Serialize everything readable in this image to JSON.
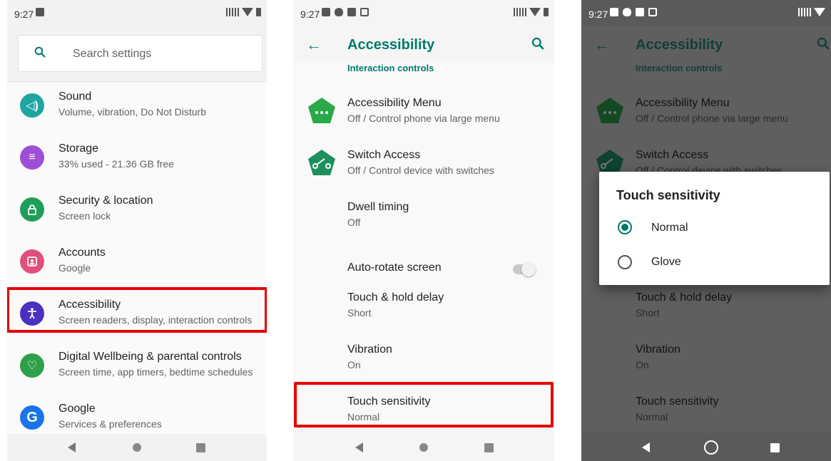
{
  "status": {
    "time": "9:27"
  },
  "screen1": {
    "search_placeholder": "Search settings",
    "items": [
      {
        "title": "Sound",
        "subtitle": "Volume, vibration, Do Not Disturb",
        "icon": "volume-icon",
        "color": "#1ea5a0"
      },
      {
        "title": "Storage",
        "subtitle": "33% used - 21.36 GB free",
        "icon": "storage-icon",
        "color": "#9c4fd6"
      },
      {
        "title": "Security & location",
        "subtitle": "Screen lock",
        "icon": "lock-icon",
        "color": "#1e9e5a"
      },
      {
        "title": "Accounts",
        "subtitle": "Google",
        "icon": "account-icon",
        "color": "#e0507b"
      },
      {
        "title": "Accessibility",
        "subtitle": "Screen readers, display, interaction controls",
        "icon": "accessibility-icon",
        "color": "#4b2fbf"
      },
      {
        "title": "Digital Wellbeing & parental controls",
        "subtitle": "Screen time, app timers, bedtime schedules",
        "icon": "wellbeing-icon",
        "color": "#2ea04a"
      },
      {
        "title": "Google",
        "subtitle": "Services & preferences",
        "icon": "google-icon",
        "color": "#1a73e8"
      }
    ]
  },
  "screen2": {
    "title": "Accessibility",
    "section": "Interaction controls",
    "items": [
      {
        "title": "Accessibility Menu",
        "subtitle": "Off / Control phone via large menu"
      },
      {
        "title": "Switch Access",
        "subtitle": "Off / Control device with switches"
      },
      {
        "title": "Dwell timing",
        "subtitle": "Off"
      },
      {
        "title": "Auto-rotate screen",
        "subtitle": ""
      },
      {
        "title": "Touch & hold delay",
        "subtitle": "Short"
      },
      {
        "title": "Vibration",
        "subtitle": "On"
      },
      {
        "title": "Touch sensitivity",
        "subtitle": "Normal"
      }
    ]
  },
  "screen3": {
    "title": "Accessibility",
    "section": "Interaction controls",
    "items": [
      {
        "title": "Accessibility Menu",
        "subtitle": "Off / Control phone via large menu"
      },
      {
        "title": "Switch Access",
        "subtitle": "Off / Control device with switches"
      },
      {
        "title": "Touch & hold delay",
        "subtitle": "Short"
      },
      {
        "title": "Vibration",
        "subtitle": "On"
      },
      {
        "title": "Touch sensitivity",
        "subtitle": "Normal"
      }
    ],
    "dialog": {
      "title": "Touch sensitivity",
      "options": [
        "Normal",
        "Glove"
      ],
      "selected": "Normal"
    }
  },
  "colors": {
    "teal": "#00796b",
    "highlight": "#e60000"
  }
}
